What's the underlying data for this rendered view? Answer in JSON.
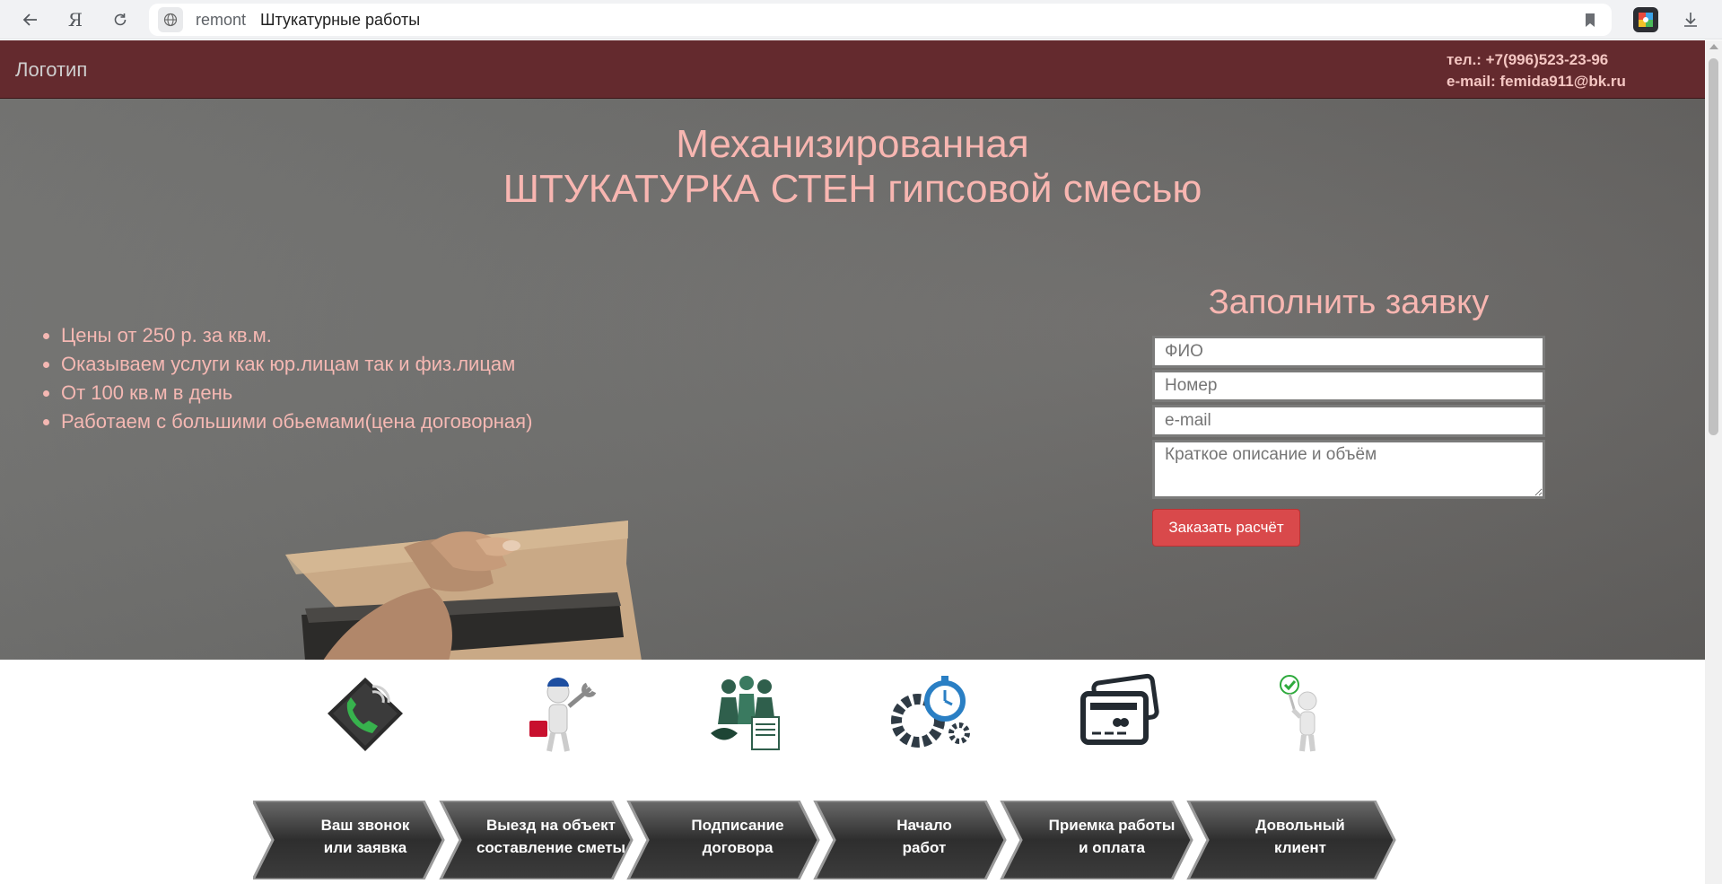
{
  "browser": {
    "domain": "remont",
    "tab_title": "Штукатурные работы",
    "home_glyph": "Я"
  },
  "header": {
    "logo": "Логотип",
    "phone": "тел.: +7(996)523-23-96",
    "email": "e-mail: femida911@bk.ru"
  },
  "hero": {
    "title_line1": "Механизированная",
    "title_line2": "ШТУКАТУРКА СТЕН гипсовой смесью",
    "benefits": [
      "Цены от 250 р. за кв.м.",
      "Оказываем услуги как юр.лицам так и физ.лицам",
      "От 100 кв.м в день",
      "Работаем с большими обьемами(цена договорная)"
    ]
  },
  "form": {
    "title": "Заполнить заявку",
    "name_placeholder": "ФИО",
    "phone_placeholder": "Номер",
    "email_placeholder": "e-mail",
    "description_placeholder": "Краткое описание и объём",
    "submit_label": "Заказать расчёт"
  },
  "steps": [
    {
      "line1": "Ваш звонок",
      "line2": "или заявка",
      "icon": "phone-icon"
    },
    {
      "line1": "Выезд на объект",
      "line2": "составление сметы",
      "icon": "worker-icon"
    },
    {
      "line1": "Подписание",
      "line2": "договора",
      "icon": "handshake-icon"
    },
    {
      "line1": "Начало",
      "line2": "работ",
      "icon": "gears-stopwatch-icon"
    },
    {
      "line1": "Приемка работы",
      "line2": "и оплата",
      "icon": "credit-card-icon"
    },
    {
      "line1": "Довольный",
      "line2": "клиент",
      "icon": "happy-client-icon"
    }
  ],
  "colors": {
    "header_bg": "#642a2e",
    "accent_text": "#f8b6b1",
    "button": "#d9494b",
    "step_arrow": "#3a3a3a"
  }
}
